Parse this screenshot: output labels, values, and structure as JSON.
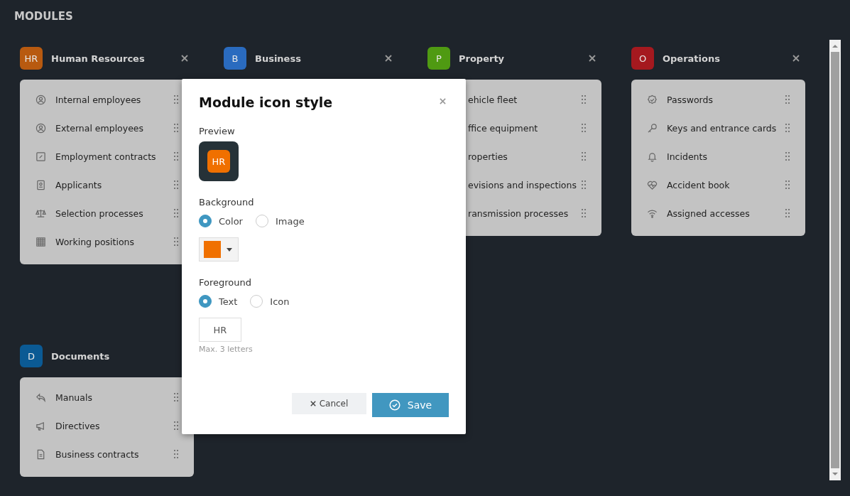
{
  "page_title": "MODULES",
  "modules": [
    {
      "badge": "HR",
      "color": "#b85a10",
      "name": "Human Resources",
      "removable": true,
      "items": [
        {
          "label": "Internal employees"
        },
        {
          "label": "External employees"
        },
        {
          "label": "Employment contracts"
        },
        {
          "label": "Applicants"
        },
        {
          "label": "Selection processes"
        },
        {
          "label": "Working positions"
        }
      ]
    },
    {
      "badge": "B",
      "color": "#2a6bbf",
      "name": "Business",
      "removable": true
    },
    {
      "badge": "P",
      "color": "#4f9a12",
      "name": "Property",
      "removable": true,
      "items": [
        {
          "label": "ehicle fleet"
        },
        {
          "label": "ffice equipment"
        },
        {
          "label": "roperties"
        },
        {
          "label": "evisions and inspections"
        },
        {
          "label": "ransmission processes"
        }
      ]
    },
    {
      "badge": "O",
      "color": "#a5191f",
      "name": "Operations",
      "removable": true,
      "items": [
        {
          "label": "Passwords"
        },
        {
          "label": "Keys and entrance cards"
        },
        {
          "label": "Incidents"
        },
        {
          "label": "Accident book"
        },
        {
          "label": "Assigned accesses"
        }
      ]
    },
    {
      "badge": "D",
      "color": "#0b5a94",
      "name": "Documents",
      "removable": false,
      "items": [
        {
          "label": "Manuals"
        },
        {
          "label": "Directives"
        },
        {
          "label": "Business contracts"
        }
      ]
    }
  ],
  "modal": {
    "title": "Module icon style",
    "preview": {
      "label": "Preview",
      "badge": "HR",
      "color": "#f07000"
    },
    "background": {
      "label": "Background",
      "options": [
        {
          "label": "Color",
          "selected": true
        },
        {
          "label": "Image",
          "selected": false
        }
      ]
    },
    "foreground": {
      "label": "Foreground",
      "options": [
        {
          "label": "Text",
          "selected": true
        },
        {
          "label": "Icon",
          "selected": false
        }
      ],
      "value": "HR",
      "hint": "Max. 3 letters"
    },
    "cancel": "Cancel",
    "save": "Save"
  }
}
